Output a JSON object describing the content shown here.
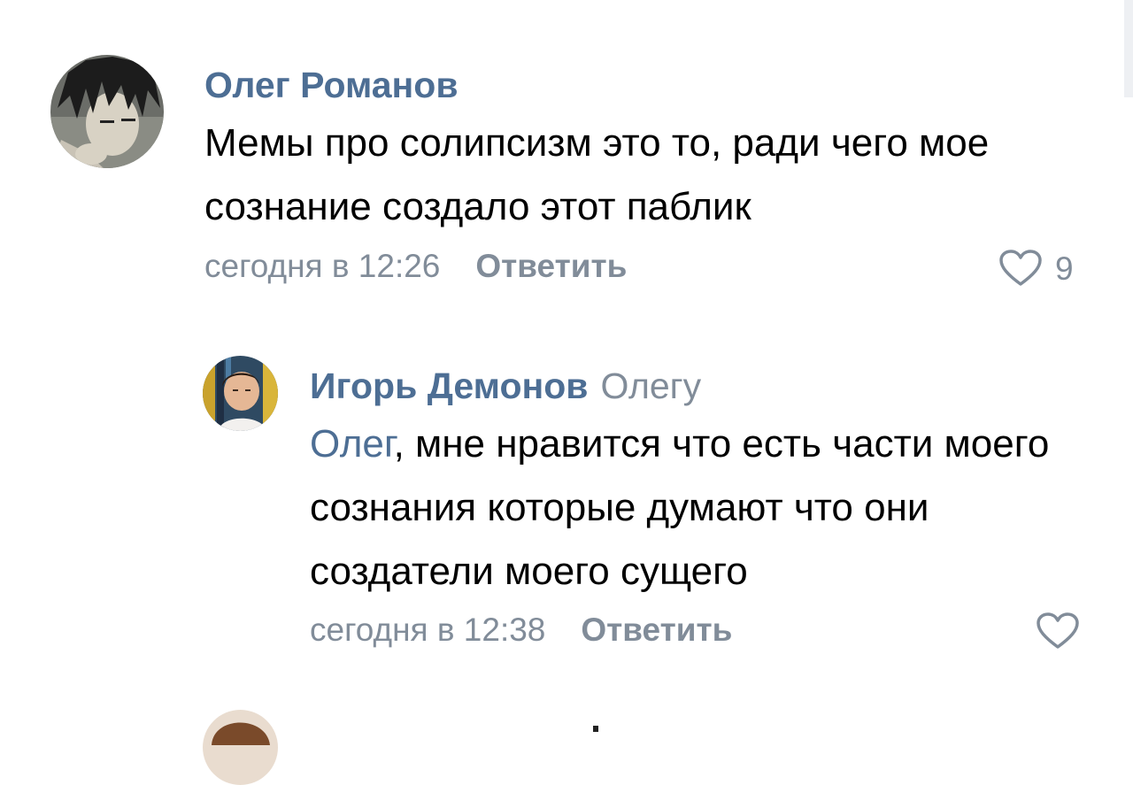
{
  "comments": [
    {
      "author": "Олег Романов",
      "text": "Мемы про солипсизм это то, ради чего мое сознание создало этот паблик",
      "time": "сегодня в 12:26",
      "reply_label": "Ответить",
      "likes": "9",
      "avatar_icon": "anime-avatar-icon"
    },
    {
      "author": "Игорь Демонов",
      "reply_to": "Олегу",
      "mention": "Олег",
      "text": ", мне нравится что есть части моего сознания которые думают что они создатели моего сущего",
      "time": "сегодня в 12:38",
      "reply_label": "Ответить",
      "avatar_icon": "photo-avatar-icon"
    }
  ],
  "colors": {
    "link": "#4d6e94",
    "secondary": "#818c99",
    "text": "#000000"
  }
}
